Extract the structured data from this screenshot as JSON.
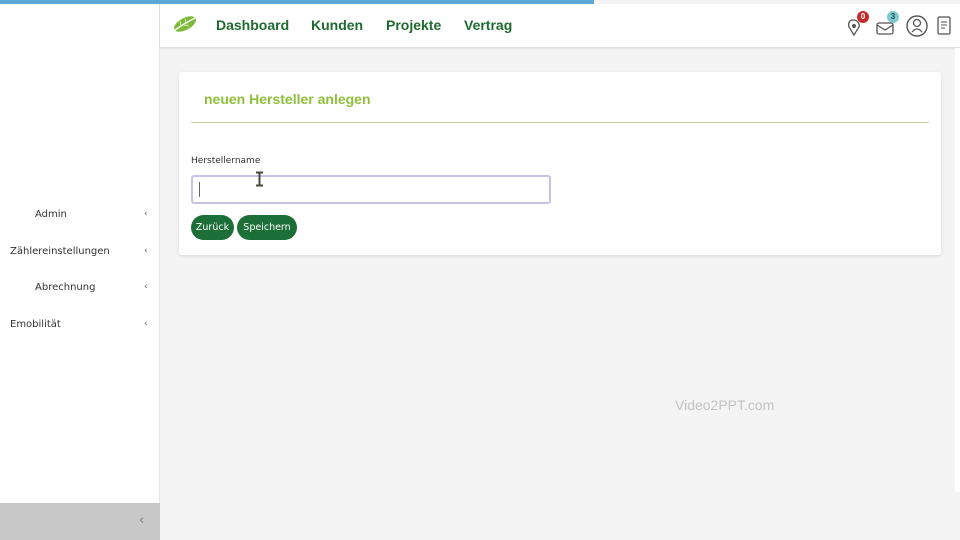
{
  "colors": {
    "nav_link": "#1f6a30",
    "title_green": "#8fbf3a",
    "button_green": "#1d6f38",
    "progress_blue": "#5aa8d6",
    "badge_red": "#c62b2b",
    "badge_teal": "#7ecad0"
  },
  "progress": {
    "fraction": 0.62
  },
  "topbar": {
    "logo_icon": "leaf-icon",
    "nav": [
      "Dashboard",
      "Kunden",
      "Projekte",
      "Vertrag"
    ],
    "icons": [
      {
        "name": "pin-notification-icon",
        "badge": "0"
      },
      {
        "name": "messages-icon",
        "badge": "3"
      },
      {
        "name": "user-profile-icon"
      },
      {
        "name": "document-icon"
      }
    ]
  },
  "sidebar": {
    "items": [
      {
        "label": "Admin",
        "chevron": "‹"
      },
      {
        "label": "Zählereinstellungen",
        "chevron": "‹"
      },
      {
        "label": "Abrechnung",
        "chevron": "‹"
      },
      {
        "label": "Emobilität",
        "chevron": "‹"
      }
    ],
    "collapse_chevron": "‹"
  },
  "form": {
    "title": "neuen Hersteller anlegen",
    "field_label": "Herstellername",
    "field_value": "",
    "back_button": "Zurück",
    "save_button": "Speichern"
  },
  "watermark": "Video2PPT.com"
}
